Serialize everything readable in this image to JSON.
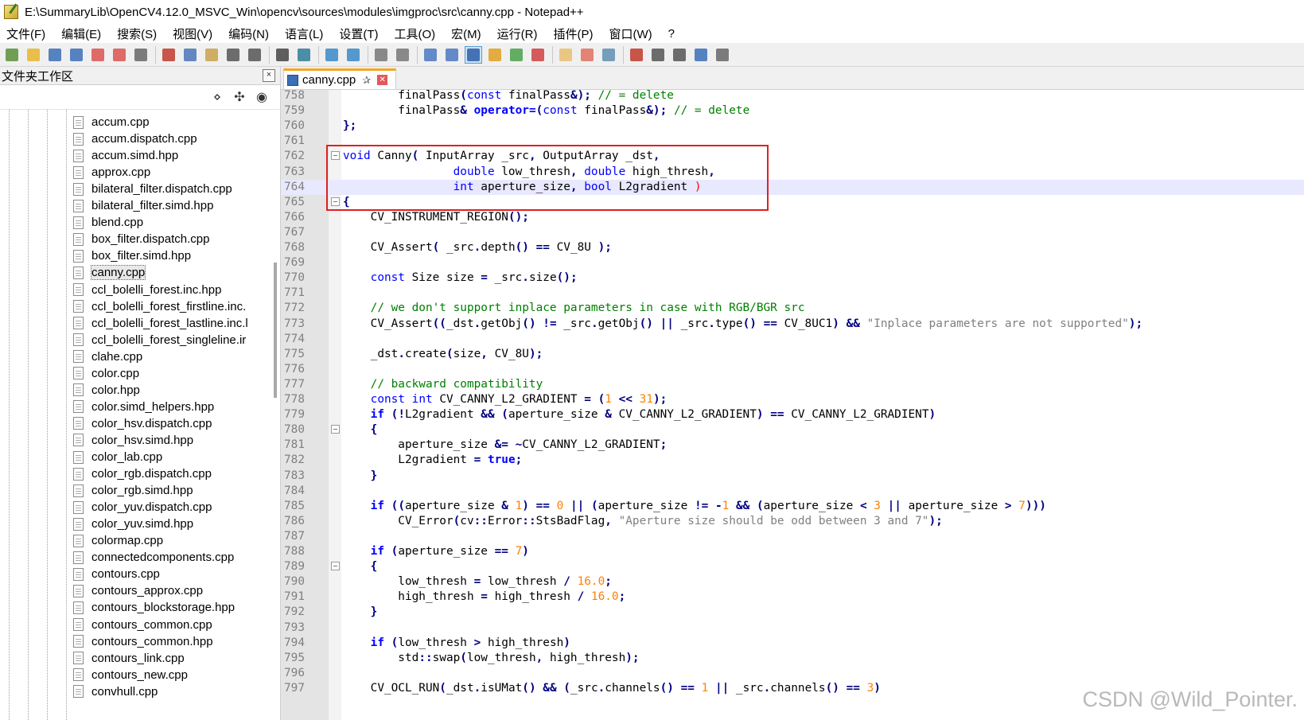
{
  "window": {
    "title": "E:\\SummaryLib\\OpenCV4.12.0_MSVC_Win\\opencv\\sources\\modules\\imgproc\\src\\canny.cpp - Notepad++"
  },
  "menu": [
    "文件(F)",
    "编辑(E)",
    "搜索(S)",
    "视图(V)",
    "编码(N)",
    "语言(L)",
    "设置(T)",
    "工具(O)",
    "宏(M)",
    "运行(R)",
    "插件(P)",
    "窗口(W)",
    "?"
  ],
  "toolbar_icons": [
    "new-file-icon",
    "open-file-icon",
    "save-icon",
    "save-all-icon",
    "close-icon",
    "close-all-icon",
    "print-icon",
    "cut-icon",
    "copy-icon",
    "paste-icon",
    "undo-icon",
    "redo-icon",
    "find-icon",
    "replace-icon",
    "zoom-in-icon",
    "zoom-out-icon",
    "sync-vertical-icon",
    "sync-horizontal-icon",
    "word-wrap-icon",
    "show-all-chars-icon",
    "indent-guide-icon",
    "udl-icon",
    "doc-map-icon",
    "function-list-icon",
    "folder-workspace-icon",
    "doc-switcher-icon",
    "monitor-icon",
    "record-macro-icon",
    "stop-macro-icon",
    "play-macro-icon",
    "run-macro-multiple-icon",
    "save-macro-icon"
  ],
  "panel": {
    "title": "文件夹工作区",
    "close": "×",
    "files": [
      "accum.cpp",
      "accum.dispatch.cpp",
      "accum.simd.hpp",
      "approx.cpp",
      "bilateral_filter.dispatch.cpp",
      "bilateral_filter.simd.hpp",
      "blend.cpp",
      "box_filter.dispatch.cpp",
      "box_filter.simd.hpp",
      "canny.cpp",
      "ccl_bolelli_forest.inc.hpp",
      "ccl_bolelli_forest_firstline.inc.",
      "ccl_bolelli_forest_lastline.inc.l",
      "ccl_bolelli_forest_singleline.ir",
      "clahe.cpp",
      "color.cpp",
      "color.hpp",
      "color.simd_helpers.hpp",
      "color_hsv.dispatch.cpp",
      "color_hsv.simd.hpp",
      "color_lab.cpp",
      "color_rgb.dispatch.cpp",
      "color_rgb.simd.hpp",
      "color_yuv.dispatch.cpp",
      "color_yuv.simd.hpp",
      "colormap.cpp",
      "connectedcomponents.cpp",
      "contours.cpp",
      "contours_approx.cpp",
      "contours_blockstorage.hpp",
      "contours_common.cpp",
      "contours_common.hpp",
      "contours_link.cpp",
      "contours_new.cpp",
      "convhull.cpp"
    ],
    "selected": "canny.cpp"
  },
  "tab": {
    "label": "canny.cpp",
    "pin": "✰",
    "close": "✕"
  },
  "editor": {
    "current_line": "764",
    "lines": [
      {
        "n": "758",
        "fold": false,
        "html": "        finalPass<span class=\"op\">(</span><span class=\"kw\">const</span> finalPass<span class=\"op\">&amp;);</span> <span class=\"cm\">// = delete</span>"
      },
      {
        "n": "759",
        "fold": false,
        "html": "        finalPass<span class=\"op\">&amp;</span> <span class=\"kw\" style=\"font-weight:bold\">operator=</span><span class=\"op\">(</span><span class=\"kw\">const</span> finalPass<span class=\"op\">&amp;);</span> <span class=\"cm\">// = delete</span>"
      },
      {
        "n": "760",
        "fold": false,
        "html": "<span class=\"op\">};</span>"
      },
      {
        "n": "761",
        "fold": false,
        "html": ""
      },
      {
        "n": "762",
        "fold": true,
        "html": "<span class=\"kw\">void</span> Canny<span class=\"op\">(</span> InputArray _src<span class=\"op\">,</span> OutputArray _dst<span class=\"op\">,</span>"
      },
      {
        "n": "763",
        "fold": false,
        "html": "                <span class=\"kw\">double</span> low_thresh<span class=\"op\">,</span> <span class=\"kw\">double</span> high_thresh<span class=\"op\">,</span>"
      },
      {
        "n": "764",
        "fold": false,
        "html": "                <span class=\"kw\">int</span> aperture_size<span class=\"op\">,</span> <span class=\"kw\">bool</span> L2gradient <span style=\"color:#ff0000\">)</span>"
      },
      {
        "n": "765",
        "fold": true,
        "html": "<span class=\"op\">{</span>"
      },
      {
        "n": "766",
        "fold": false,
        "html": "    CV_INSTRUMENT_REGION<span class=\"op\">();</span>"
      },
      {
        "n": "767",
        "fold": false,
        "html": ""
      },
      {
        "n": "768",
        "fold": false,
        "html": "    CV_Assert<span class=\"op\">(</span> _src<span class=\"op\">.</span>depth<span class=\"op\">()</span> <span class=\"op\">==</span> CV_8U <span class=\"op\">);</span>"
      },
      {
        "n": "769",
        "fold": false,
        "html": ""
      },
      {
        "n": "770",
        "fold": false,
        "html": "    <span class=\"kw\">const</span> Size size <span class=\"op\">=</span> _src<span class=\"op\">.</span>size<span class=\"op\">();</span>"
      },
      {
        "n": "771",
        "fold": false,
        "html": ""
      },
      {
        "n": "772",
        "fold": false,
        "html": "    <span class=\"cm\">// we don't support inplace parameters in case with RGB/BGR src</span>"
      },
      {
        "n": "773",
        "fold": false,
        "html": "    CV_Assert<span class=\"op\">((</span>_dst<span class=\"op\">.</span>getObj<span class=\"op\">()</span> <span class=\"op\">!=</span> _src<span class=\"op\">.</span>getObj<span class=\"op\">()</span> <span class=\"op\">||</span> _src<span class=\"op\">.</span>type<span class=\"op\">()</span> <span class=\"op\">==</span> CV_8UC1<span class=\"op\">)</span> <span class=\"op\">&amp;&amp;</span> <span class=\"str\">\"Inplace parameters are not supported\"</span><span class=\"op\">);</span>"
      },
      {
        "n": "774",
        "fold": false,
        "html": ""
      },
      {
        "n": "775",
        "fold": false,
        "html": "    _dst<span class=\"op\">.</span>create<span class=\"op\">(</span>size<span class=\"op\">,</span> CV_8U<span class=\"op\">);</span>"
      },
      {
        "n": "776",
        "fold": false,
        "html": ""
      },
      {
        "n": "777",
        "fold": false,
        "html": "    <span class=\"cm\">// backward compatibility</span>"
      },
      {
        "n": "778",
        "fold": false,
        "html": "    <span class=\"kw\">const</span> <span class=\"kw\">int</span> CV_CANNY_L2_GRADIENT <span class=\"op\">=</span> <span class=\"op\">(</span><span class=\"num\">1</span> <span class=\"op\">&lt;&lt;</span> <span class=\"num\">31</span><span class=\"op\">);</span>"
      },
      {
        "n": "779",
        "fold": false,
        "html": "    <span class=\"kw\" style=\"font-weight:bold\">if</span> <span class=\"op\">(!</span>L2gradient <span class=\"op\">&amp;&amp;</span> <span class=\"op\">(</span>aperture_size <span class=\"op\">&amp;</span> CV_CANNY_L2_GRADIENT<span class=\"op\">)</span> <span class=\"op\">==</span> CV_CANNY_L2_GRADIENT<span class=\"op\">)</span>"
      },
      {
        "n": "780",
        "fold": true,
        "html": "    <span class=\"op\">{</span>"
      },
      {
        "n": "781",
        "fold": false,
        "html": "        aperture_size <span class=\"op\">&amp;=</span> <span class=\"op\">~</span>CV_CANNY_L2_GRADIENT<span class=\"op\">;</span>"
      },
      {
        "n": "782",
        "fold": false,
        "html": "        L2gradient <span class=\"op\">=</span> <span class=\"kw\" style=\"font-weight:bold\">true</span><span class=\"op\">;</span>"
      },
      {
        "n": "783",
        "fold": false,
        "html": "    <span class=\"op\">}</span>"
      },
      {
        "n": "784",
        "fold": false,
        "html": ""
      },
      {
        "n": "785",
        "fold": false,
        "html": "    <span class=\"kw\" style=\"font-weight:bold\">if</span> <span class=\"op\">((</span>aperture_size <span class=\"op\">&amp;</span> <span class=\"num\">1</span><span class=\"op\">)</span> <span class=\"op\">==</span> <span class=\"num\">0</span> <span class=\"op\">||</span> <span class=\"op\">(</span>aperture_size <span class=\"op\">!=</span> <span class=\"op\">-</span><span class=\"num\">1</span> <span class=\"op\">&amp;&amp;</span> <span class=\"op\">(</span>aperture_size <span class=\"op\">&lt;</span> <span class=\"num\">3</span> <span class=\"op\">||</span> aperture_size <span class=\"op\">&gt;</span> <span class=\"num\">7</span><span class=\"op\">)))</span>"
      },
      {
        "n": "786",
        "fold": false,
        "html": "        CV_Error<span class=\"op\">(</span>cv<span class=\"op\">::</span>Error<span class=\"op\">::</span>StsBadFlag<span class=\"op\">,</span> <span class=\"str\">\"Aperture size should be odd between 3 and 7\"</span><span class=\"op\">);</span>"
      },
      {
        "n": "787",
        "fold": false,
        "html": ""
      },
      {
        "n": "788",
        "fold": false,
        "html": "    <span class=\"kw\" style=\"font-weight:bold\">if</span> <span class=\"op\">(</span>aperture_size <span class=\"op\">==</span> <span class=\"num\">7</span><span class=\"op\">)</span>"
      },
      {
        "n": "789",
        "fold": true,
        "html": "    <span class=\"op\">{</span>"
      },
      {
        "n": "790",
        "fold": false,
        "html": "        low_thresh <span class=\"op\">=</span> low_thresh <span class=\"op\">/</span> <span class=\"num\">16.0</span><span class=\"op\">;</span>"
      },
      {
        "n": "791",
        "fold": false,
        "html": "        high_thresh <span class=\"op\">=</span> high_thresh <span class=\"op\">/</span> <span class=\"num\">16.0</span><span class=\"op\">;</span>"
      },
      {
        "n": "792",
        "fold": false,
        "html": "    <span class=\"op\">}</span>"
      },
      {
        "n": "793",
        "fold": false,
        "html": ""
      },
      {
        "n": "794",
        "fold": false,
        "html": "    <span class=\"kw\" style=\"font-weight:bold\">if</span> <span class=\"op\">(</span>low_thresh <span class=\"op\">&gt;</span> high_thresh<span class=\"op\">)</span>"
      },
      {
        "n": "795",
        "fold": false,
        "html": "        std<span class=\"op\">::</span>swap<span class=\"op\">(</span>low_thresh<span class=\"op\">,</span> high_thresh<span class=\"op\">);</span>"
      },
      {
        "n": "796",
        "fold": false,
        "html": ""
      },
      {
        "n": "797",
        "fold": false,
        "html": "    CV_OCL_RUN<span class=\"op\">(</span>_dst<span class=\"op\">.</span>isUMat<span class=\"op\">()</span> <span class=\"op\">&amp;&amp;</span> <span class=\"op\">(</span>_src<span class=\"op\">.</span>channels<span class=\"op\">()</span> <span class=\"op\">==</span> <span class=\"num\">1</span> <span class=\"op\">||</span> _src<span class=\"op\">.</span>channels<span class=\"op\">()</span> <span class=\"op\">==</span> <span class=\"num\">3</span><span class=\"op\">)</span>"
      }
    ]
  },
  "watermark": "CSDN @Wild_Pointer."
}
